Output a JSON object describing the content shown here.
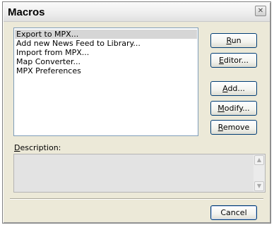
{
  "window": {
    "title": "Macros",
    "close_symbol": "✕"
  },
  "macro_list": {
    "items": [
      {
        "label": "Export to MPX...",
        "selected": true
      },
      {
        "label": "Add new News Feed to Library...",
        "selected": false
      },
      {
        "label": "Import from MPX...",
        "selected": false
      },
      {
        "label": "Map Converter...",
        "selected": false
      },
      {
        "label": "MPX Preferences",
        "selected": false
      }
    ]
  },
  "buttons": {
    "run": {
      "accel": "R",
      "rest": "un"
    },
    "editor": {
      "pre": "",
      "accel": "E",
      "rest": "ditor..."
    },
    "add": {
      "accel": "A",
      "rest": "dd..."
    },
    "modify": {
      "accel": "M",
      "rest": "odify..."
    },
    "remove": {
      "accel": "R",
      "rest": "emove"
    },
    "cancel": "Cancel"
  },
  "description": {
    "label_accel": "D",
    "label_rest": "escription:",
    "value": ""
  },
  "icons": {
    "close": "close-icon",
    "scroll_up": "scroll-up-arrow-icon",
    "scroll_down": "scroll-down-arrow-icon"
  }
}
